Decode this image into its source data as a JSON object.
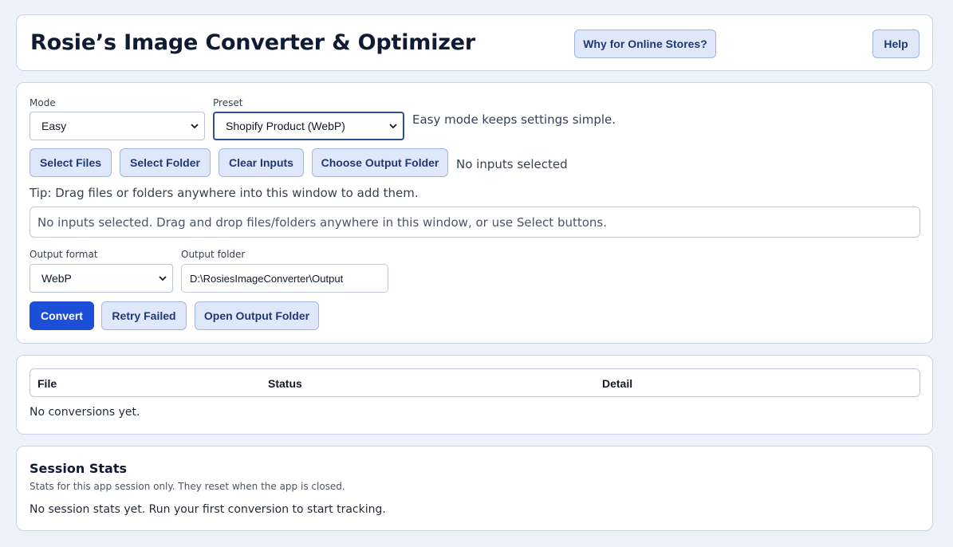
{
  "header": {
    "title": "Rosie’s Image Converter & Optimizer",
    "why_button": "Why for Online Stores?",
    "help_button": "Help"
  },
  "settings": {
    "mode_label": "Mode",
    "mode_value": "Easy",
    "preset_label": "Preset",
    "preset_value": "Shopify Product (WebP)",
    "mode_hint": "Easy mode keeps settings simple.",
    "select_files": "Select Files",
    "select_folder": "Select Folder",
    "clear_inputs": "Clear Inputs",
    "choose_output_folder": "Choose Output Folder",
    "inputs_status": "No inputs selected",
    "tip": "Tip: Drag files or folders anywhere into this window to add them.",
    "dropzone_text": "No inputs selected. Drag and drop files/folders anywhere in this window, or use Select buttons.",
    "output_format_label": "Output format",
    "output_format_value": "WebP",
    "output_folder_label": "Output folder",
    "output_folder_value": "D:\\RosiesImageConverter\\Output",
    "convert": "Convert",
    "retry_failed": "Retry Failed",
    "open_output_folder": "Open Output Folder"
  },
  "results": {
    "columns": [
      "File",
      "Status",
      "Detail"
    ],
    "empty_text": "No conversions yet."
  },
  "stats": {
    "title": "Session Stats",
    "subtitle": "Stats for this app session only. They reset when the app is closed.",
    "empty_text": "No session stats yet. Run your first conversion to start tracking."
  },
  "icons": {
    "dropdown": "chevron-down-icon"
  }
}
